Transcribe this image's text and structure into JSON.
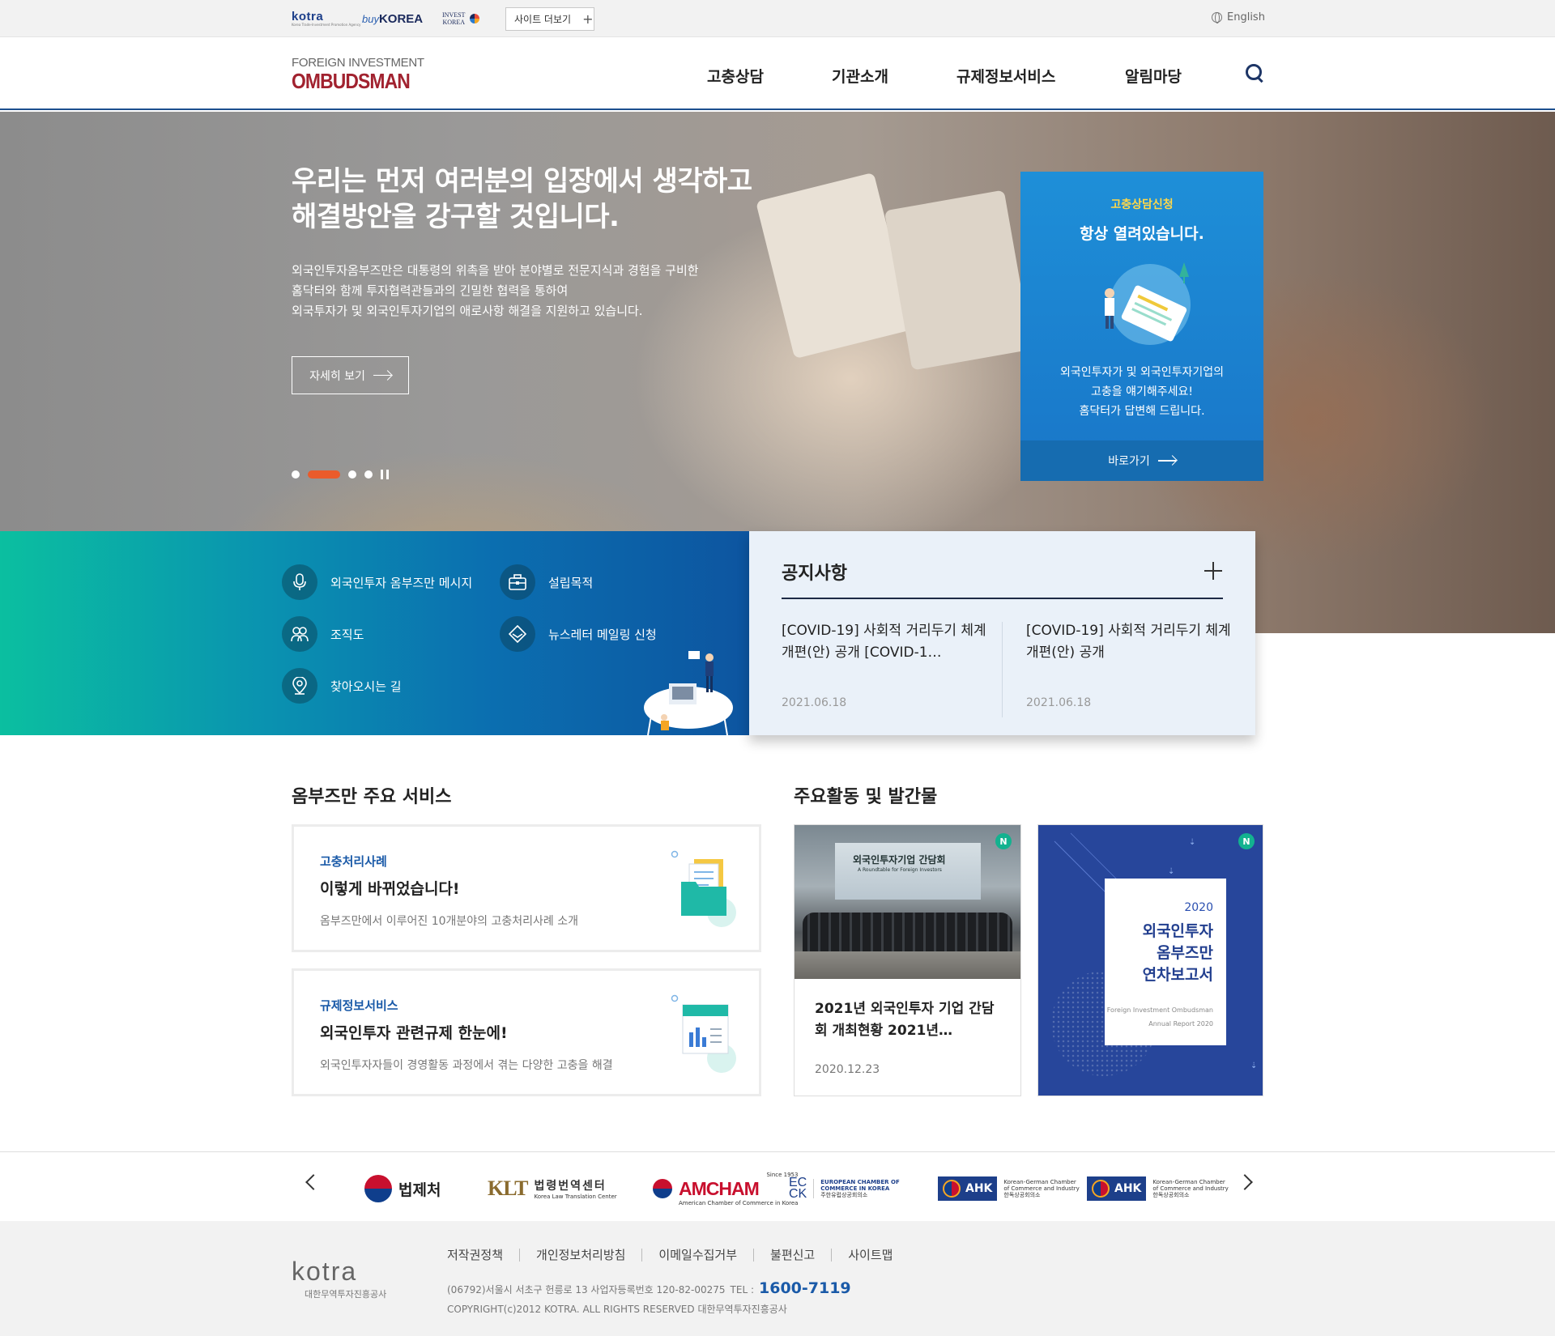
{
  "topbar": {
    "kotra_logo": "kotra",
    "kotra_sub": "Korea Trade-Investment Promotion Agency",
    "buykorea_buy": "buy",
    "buykorea_korea": "KOREA",
    "investkorea_line1": "INVEST",
    "investkorea_line2": "KOREA",
    "more_sites": "사이트 더보기",
    "language": "English"
  },
  "header": {
    "logo_line1": "FOREIGN INVESTMENT",
    "logo_line2": "OMBUDSMAN",
    "nav": [
      "고충상담",
      "기관소개",
      "규제정보서비스",
      "알림마당"
    ]
  },
  "hero": {
    "title_line1": "우리는 먼저 여러분의 입장에서 생각하고",
    "title_line2": "해결방안을 강구할 것입니다.",
    "desc_line1": "외국인투자옴부즈만은 대통령의 위촉을 받아 분야별로 전문지식과 경험을 구비한",
    "desc_line2": "홈닥터와 함께 투자협력관들과의 긴밀한 협력을 통하여",
    "desc_line3": "외국투자가 및 외국인투자기업의 애로사항 해결을 지원하고 있습니다.",
    "detail_button": "자세히 보기",
    "slide_count": 4,
    "active_slide": 2
  },
  "consult": {
    "label": "고충상담신청",
    "title": "항상 열려있습니다.",
    "desc_line1": "외국인투자가 및 외국인투자기업의",
    "desc_line2": "고충을 얘기해주세요!",
    "desc_line3": "홈닥터가 답변해 드립니다.",
    "go_button": "바로가기"
  },
  "quick_links": [
    {
      "label": "외국인투자 옴부즈만 메시지",
      "icon": "microphone-icon"
    },
    {
      "label": "설립목적",
      "icon": "briefcase-icon"
    },
    {
      "label": "조직도",
      "icon": "people-icon"
    },
    {
      "label": "뉴스레터 메일링 신청",
      "icon": "mail-icon"
    },
    {
      "label": "찾아오시는 길",
      "icon": "location-pin-icon"
    }
  ],
  "notice": {
    "title": "공지사항",
    "items": [
      {
        "title": "[COVID-19] 사회적 거리두기 체계 개편(안) 공개 [COVID-1…",
        "date": "2021.06.18"
      },
      {
        "title": "[COVID-19] 사회적 거리두기 체계 개편(안) 공개",
        "date": "2021.06.18"
      }
    ]
  },
  "services": {
    "title": "옴부즈만 주요 서비스",
    "items": [
      {
        "category": "고충처리사례",
        "headline": "이렇게 바뀌었습니다!",
        "desc": "옴부즈만에서 이루어진 10개분야의 고충처리사례 소개"
      },
      {
        "category": "규제정보서비스",
        "headline": "외국인투자 관련규제 한눈에!",
        "desc": "외국인투자자들이 경영활동 과정에서 겪는 다양한 고충을 해결"
      }
    ]
  },
  "activities": {
    "title": "주요활동 및 발간물",
    "new_badge": "N",
    "photo_banner_title": "외국인투자기업 간담회",
    "photo_banner_sub": "A Roundtable for Foreign Investors",
    "item1": {
      "title": "2021년 외국인투자 기업 간담회 개최현황 2021년…",
      "date": "2020.12.23"
    },
    "report": {
      "year": "2020",
      "title_line1": "외국인투자",
      "title_line2": "옴부즈만",
      "title_line3": "연차보고서",
      "en_line1": "Foreign Investment Ombudsman",
      "en_line2": "Annual Report 2020"
    }
  },
  "partners": {
    "moleg": "법제처",
    "klt": "KLT",
    "klt_name": "법령번역센터",
    "klt_en": "Korea Law Translation Center",
    "amcham": "AMCHAM",
    "amcham_since": "Since 1953",
    "amcham_en": "American Chamber of Commerce in Korea",
    "ecck_l1": "EC",
    "ecck_l2": "CK",
    "ecck_en1": "EUROPEAN CHAMBER OF",
    "ecck_en2": "COMMERCE IN KOREA",
    "ecck_ko": "주한유럽상공회의소",
    "ahk": "AHK",
    "ahk_en1": "Korean-German Chamber",
    "ahk_en2": "of Commerce and Industry",
    "ahk_ko": "한독상공회의소"
  },
  "footer": {
    "logo": "kotra",
    "logo_sub": "대한무역투자진흥공사",
    "links": [
      "저작권정책",
      "개인정보처리방침",
      "이메일수집거부",
      "불편신고",
      "사이트맵"
    ],
    "address": "(06792)서울시 서초구 헌릉로 13   사업자등록번호 120-82-00275",
    "tel_label": "TEL :",
    "tel": "1600-7119",
    "copyright": "COPYRIGHT(c)2012 KOTRA. ALL RIGHTS RESERVED 대한무역투자진흥공사"
  },
  "colors": {
    "brand_navy": "#1c4f8f",
    "brand_red": "#a1222f",
    "accent_orange": "#ea5b2b",
    "consult_blue": "#1e8fd8",
    "teal": "#0bbfa0",
    "link_blue": "#1a5aa8"
  }
}
